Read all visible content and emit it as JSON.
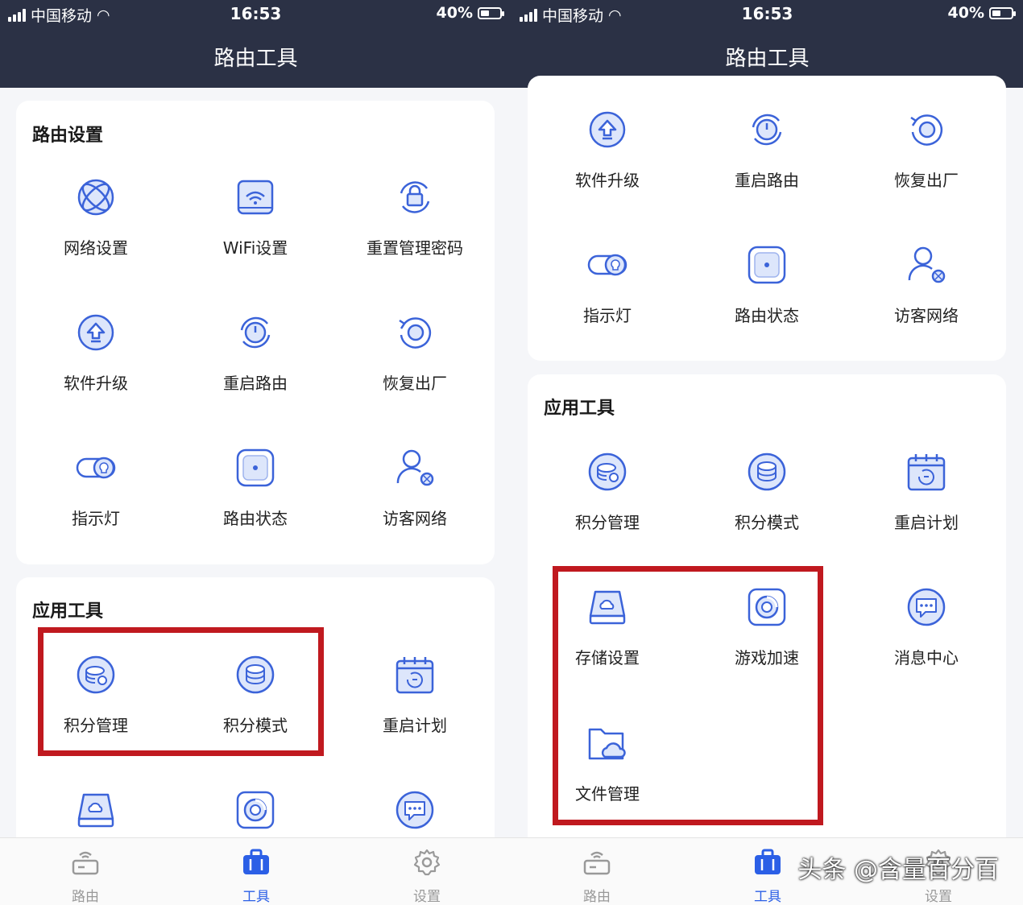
{
  "status": {
    "carrier": "中国移动",
    "time": "16:53",
    "battery": "40%"
  },
  "app_title": "路由工具",
  "sections": {
    "router_settings": "路由设置",
    "app_tools": "应用工具"
  },
  "router_items": [
    {
      "label": "网络设置",
      "icon": "network-globe-icon"
    },
    {
      "label": "WiFi设置",
      "icon": "wifi-router-icon"
    },
    {
      "label": "重置管理密码",
      "icon": "lock-reset-icon"
    },
    {
      "label": "软件升级",
      "icon": "upgrade-arrow-icon"
    },
    {
      "label": "重启路由",
      "icon": "restart-power-icon"
    },
    {
      "label": "恢复出厂",
      "icon": "factory-reset-icon"
    },
    {
      "label": "指示灯",
      "icon": "toggle-bulb-icon"
    },
    {
      "label": "路由状态",
      "icon": "router-status-icon"
    },
    {
      "label": "访客网络",
      "icon": "guest-user-icon"
    }
  ],
  "tool_items": [
    {
      "label": "积分管理",
      "icon": "coin-manage-icon"
    },
    {
      "label": "积分模式",
      "icon": "coin-mode-icon"
    },
    {
      "label": "重启计划",
      "icon": "calendar-restart-icon"
    },
    {
      "label": "存储设置",
      "icon": "storage-cloud-icon"
    },
    {
      "label": "游戏加速",
      "icon": "game-boost-icon"
    },
    {
      "label": "消息中心",
      "icon": "message-bubble-icon"
    },
    {
      "label": "文件管理",
      "icon": "folder-cloud-icon"
    }
  ],
  "tabs": [
    {
      "label": "路由",
      "icon": "router-tab-icon"
    },
    {
      "label": "工具",
      "icon": "toolbox-tab-icon"
    },
    {
      "label": "设置",
      "icon": "gear-tab-icon"
    }
  ],
  "watermark": "头条 @含量百分百",
  "colors": {
    "header": "#2b3145",
    "accent": "#2b5fe6",
    "highlight": "#c0191f"
  }
}
